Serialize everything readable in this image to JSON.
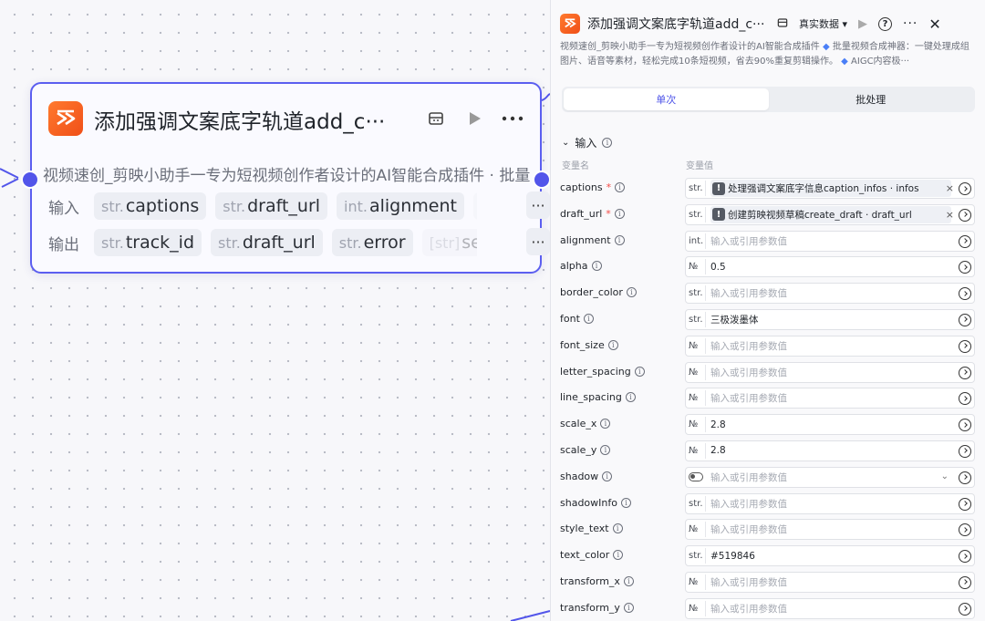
{
  "node": {
    "title": "添加强调文案底字轨道add_c···",
    "description": "视频速创_剪映小助手一专为短视频创作者设计的AI智能合成插件 · 批量视频合成神器",
    "input_label": "输入",
    "output_label": "输出",
    "inputs": [
      {
        "type": "str.",
        "name": "captions"
      },
      {
        "type": "str.",
        "name": "draft_url"
      },
      {
        "type": "int.",
        "name": "alignment"
      },
      {
        "type": "N",
        "name": ""
      }
    ],
    "outputs": [
      {
        "type": "str.",
        "name": "track_id"
      },
      {
        "type": "str.",
        "name": "draft_url"
      },
      {
        "type": "str.",
        "name": "error"
      },
      {
        "type": "[str]",
        "name": "seg"
      }
    ]
  },
  "panel": {
    "title": "添加强调文案底字轨道add_c···",
    "data_mode": "真实数据",
    "description_1": "视频速创_剪映小助手一专为短视频创作者设计的AI智能合成插件",
    "description_2": "批量视频合成神器：一键处理成组图片、语音等素材，轻松完成10条短视频，省去90%重复剪辑操作。",
    "description_3": "AIGC内容极···",
    "tabs": [
      "单次",
      "批处理"
    ],
    "section_label": "输入",
    "col_name": "变量名",
    "col_value": "变量值",
    "placeholder": "输入或引用参数值",
    "params": [
      {
        "name": "captions",
        "required": true,
        "type": "str.",
        "ref": true,
        "value": "处理强调文案底字信息caption_infos · infos"
      },
      {
        "name": "draft_url",
        "required": true,
        "type": "str.",
        "ref": true,
        "value": "创建剪映视频草稿create_draft · draft_url"
      },
      {
        "name": "alignment",
        "required": false,
        "type": "int.",
        "value": ""
      },
      {
        "name": "alpha",
        "required": false,
        "type": "№",
        "value": "0.5"
      },
      {
        "name": "border_color",
        "required": false,
        "type": "str.",
        "value": ""
      },
      {
        "name": "font",
        "required": false,
        "type": "str.",
        "value": "三极泼墨体"
      },
      {
        "name": "font_size",
        "required": false,
        "type": "№",
        "value": ""
      },
      {
        "name": "letter_spacing",
        "required": false,
        "type": "№",
        "value": ""
      },
      {
        "name": "line_spacing",
        "required": false,
        "type": "№",
        "value": ""
      },
      {
        "name": "scale_x",
        "required": false,
        "type": "№",
        "value": "2.8"
      },
      {
        "name": "scale_y",
        "required": false,
        "type": "№",
        "value": "2.8"
      },
      {
        "name": "shadow",
        "required": false,
        "type": "toggle",
        "value": "",
        "select": true
      },
      {
        "name": "shadowInfo",
        "required": false,
        "type": "str.",
        "value": ""
      },
      {
        "name": "style_text",
        "required": false,
        "type": "№",
        "value": ""
      },
      {
        "name": "text_color",
        "required": false,
        "type": "str.",
        "value": "#519846"
      },
      {
        "name": "transform_x",
        "required": false,
        "type": "№",
        "value": ""
      },
      {
        "name": "transform_y",
        "required": false,
        "type": "№",
        "value": ""
      }
    ]
  },
  "colors": {
    "accent": "#4d53e8",
    "node_border": "#5b5ef0",
    "brand_orange": "#f04f18"
  }
}
